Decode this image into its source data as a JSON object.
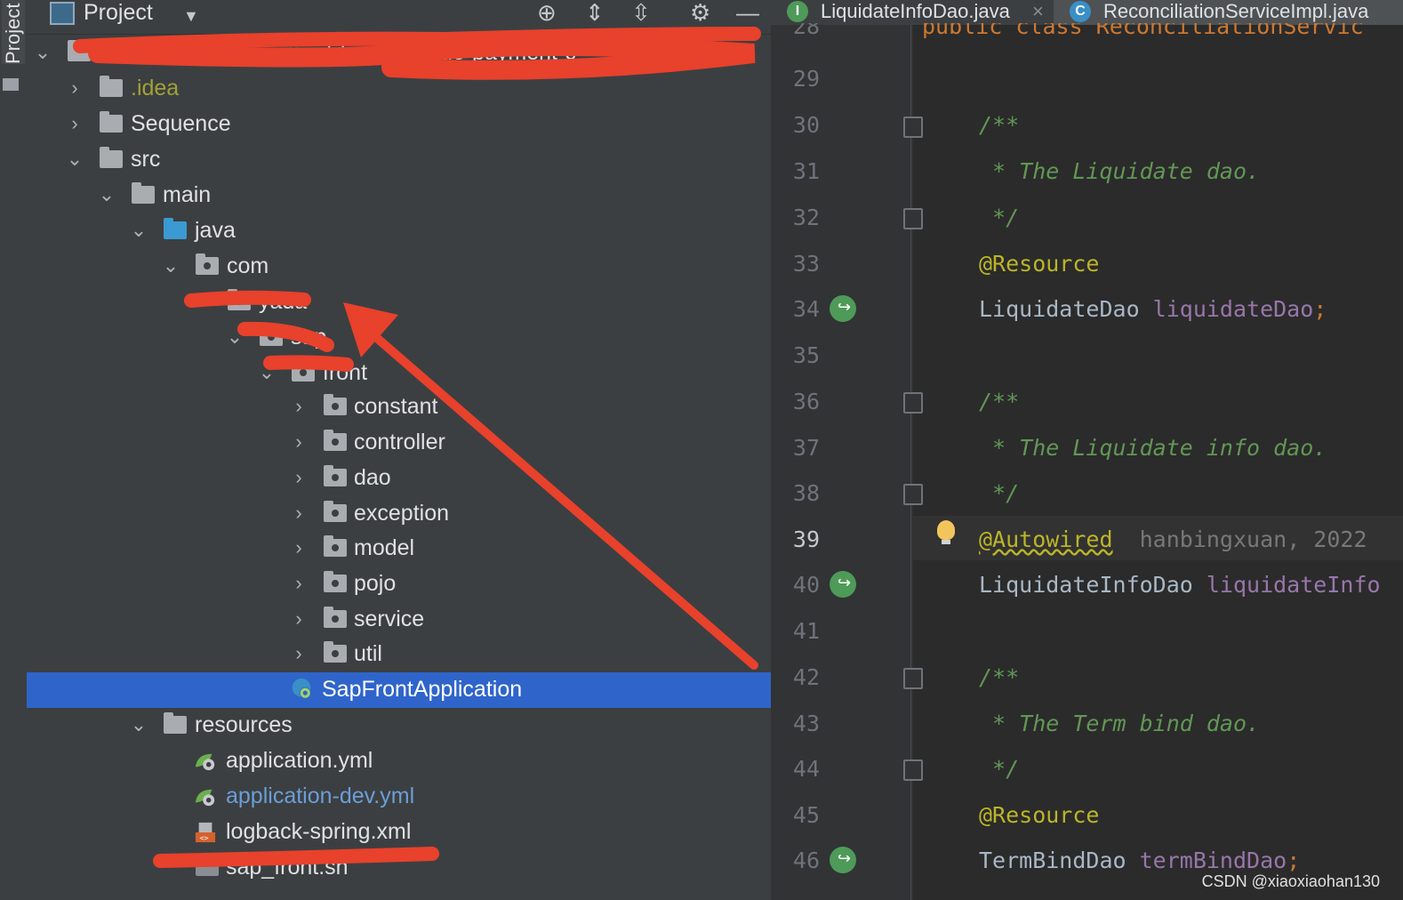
{
  "side_strip": {
    "label": "Project"
  },
  "panel": {
    "title": "Project"
  },
  "tree": {
    "root_label": "ningbo-qrcode-payment-front [qrcode-payment-c",
    "idea": ".idea",
    "sequence": "Sequence",
    "src": "src",
    "main": "main",
    "java": "java",
    "com": "com",
    "pkg1": "yada",
    "pkg2": "sap",
    "pkg3": "front",
    "constant": "constant",
    "controller": "controller",
    "dao": "dao",
    "exception": "exception",
    "model": "model",
    "pojo": "pojo",
    "service": "service",
    "util": "util",
    "app_class": "SapFrontApplication",
    "resources": "resources",
    "app_yml": "application.yml",
    "app_dev_yml": "application-dev.yml",
    "logback": "logback-spring.xml",
    "sh": "sap_front.sh"
  },
  "tabs": [
    {
      "icon": "I",
      "label": "LiquidateInfoDao.java",
      "close": "×"
    },
    {
      "icon": "C",
      "label": "ReconciliationServiceImpl.java"
    }
  ],
  "editor": {
    "line_top": "28",
    "code_top": "public class ReconciliationServic",
    "lines": [
      "29",
      "30",
      "31",
      "32",
      "33",
      "34",
      "35",
      "36",
      "37",
      "38",
      "39",
      "40",
      "41",
      "42",
      "43",
      "44",
      "45",
      "46"
    ],
    "c30": "/**",
    "c31": " * The Liquidate dao.",
    "c32": " */",
    "c33": "@Resource",
    "c34_type": "LiquidateDao ",
    "c34_field": "liquidateDao",
    "c34_semi": ";",
    "c36": "/**",
    "c37": " * The Liquidate info dao.",
    "c38": " */",
    "c39": "@Autowired",
    "c39_blame": "hanbingxuan, 2022",
    "c40_type": "LiquidateInfoDao ",
    "c40_field": "liquidateInfo",
    "c42": "/**",
    "c43": " * The Term bind dao.",
    "c44": " */",
    "c45": "@Resource",
    "c46_type": "TermBindDao ",
    "c46_field": "termBindDao",
    "c46_semi": ";"
  },
  "watermark": "CSDN @xiaoxiaohan130",
  "colors": {
    "selection": "#2f65ca",
    "annotation_red": "#e8412c",
    "comment": "#629755",
    "annotation": "#bbb529",
    "field": "#9876aa"
  }
}
